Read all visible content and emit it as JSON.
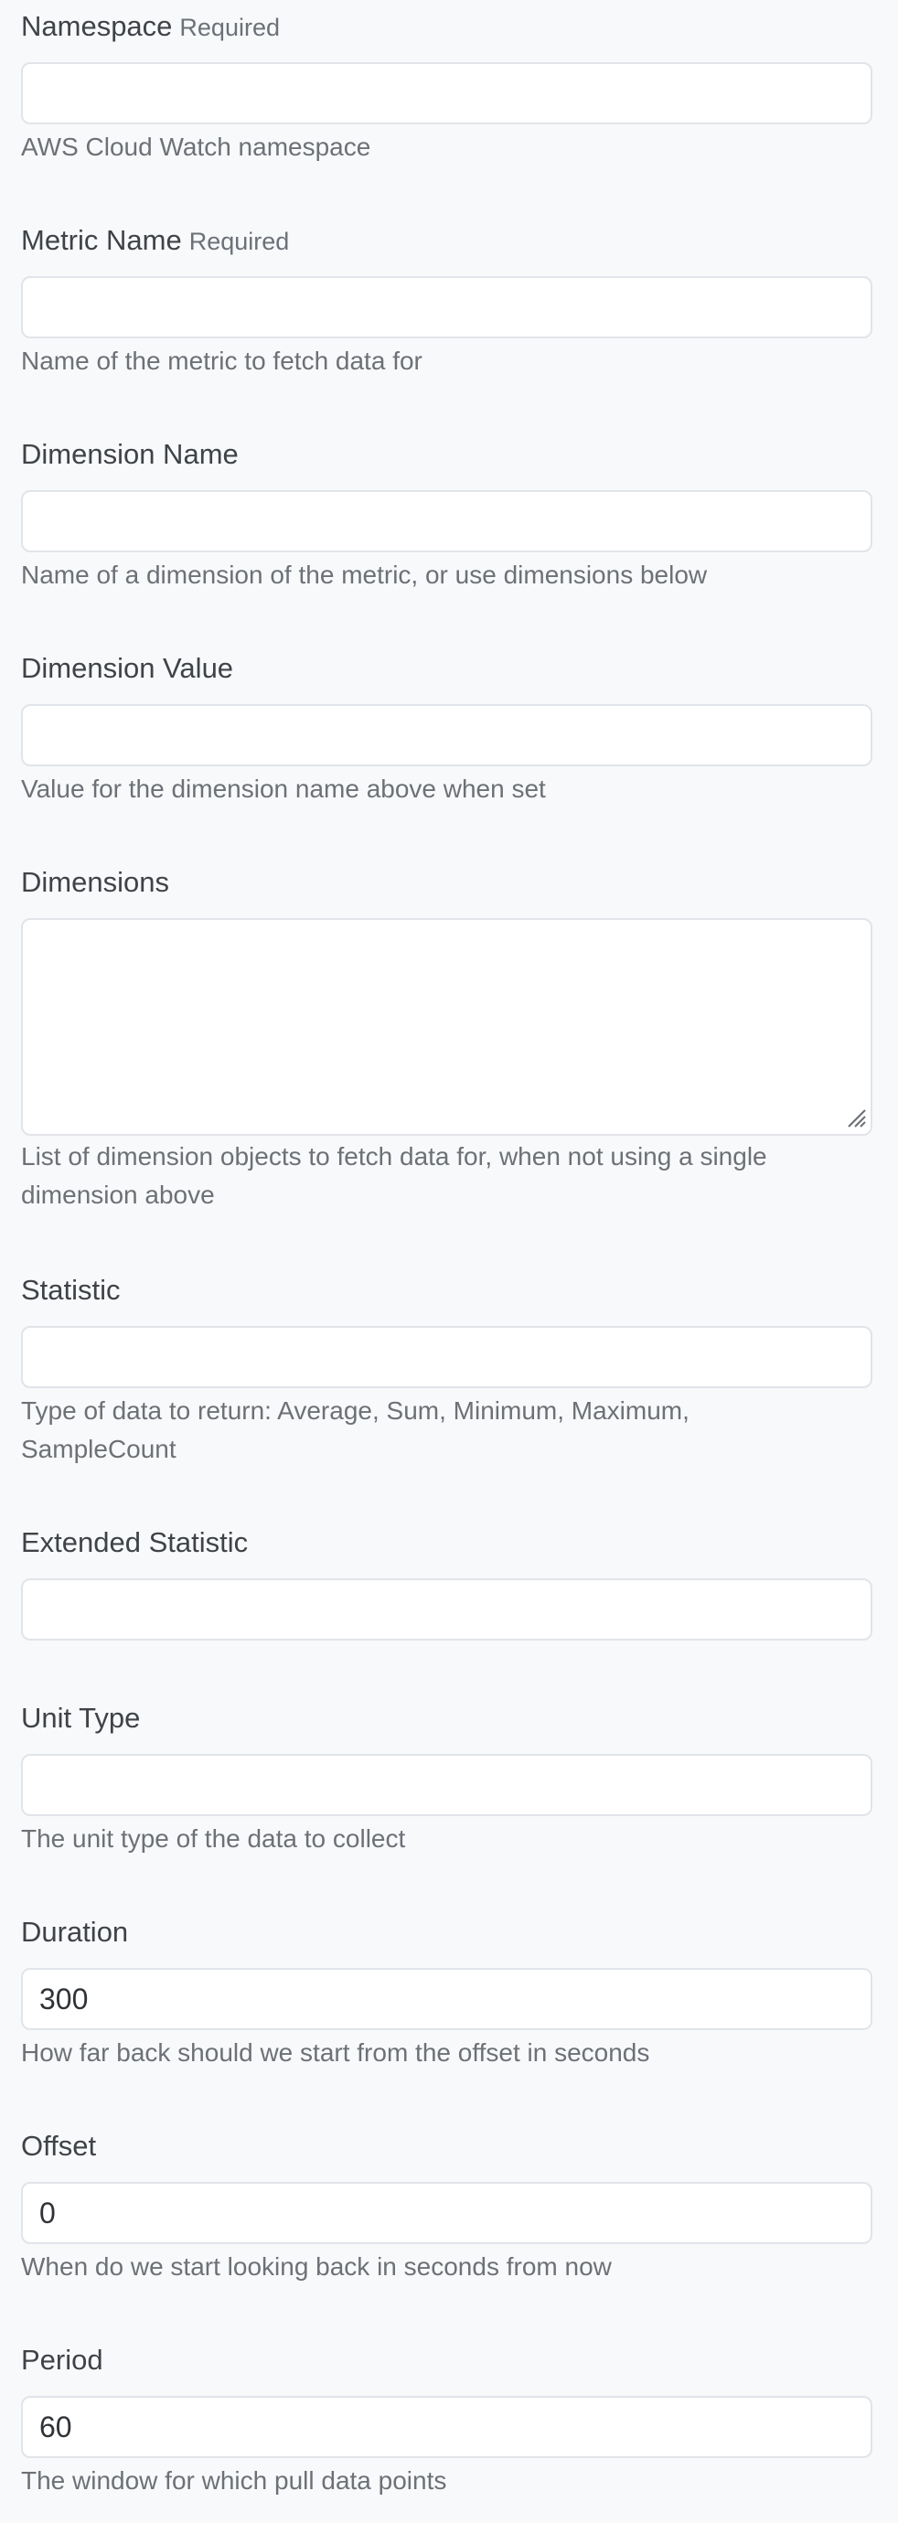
{
  "form": {
    "namespace": {
      "label": "Namespace",
      "required": "Required",
      "value": "",
      "help": "AWS Cloud Watch namespace"
    },
    "metric_name": {
      "label": "Metric Name",
      "required": "Required",
      "value": "",
      "help": "Name of the metric to fetch data for"
    },
    "dimension_name": {
      "label": "Dimension Name",
      "value": "",
      "help": "Name of a dimension of the metric, or use dimensions below"
    },
    "dimension_value": {
      "label": "Dimension Value",
      "value": "",
      "help": "Value for the dimension name above when set"
    },
    "dimensions": {
      "label": "Dimensions",
      "value": "",
      "help": "List of dimension objects to fetch data for, when not using a single dimension above"
    },
    "statistic": {
      "label": "Statistic",
      "value": "",
      "help": "Type of data to return: Average, Sum, Minimum, Maximum, SampleCount"
    },
    "extended_statistic": {
      "label": "Extended Statistic",
      "value": ""
    },
    "unit_type": {
      "label": "Unit Type",
      "value": "",
      "help": "The unit type of the data to collect"
    },
    "duration": {
      "label": "Duration",
      "value": "300",
      "help": "How far back should we start from the offset in seconds"
    },
    "offset": {
      "label": "Offset",
      "value": "0",
      "help": "When do we start looking back in seconds from now"
    },
    "period": {
      "label": "Period",
      "value": "60",
      "help": "The window for which pull data points"
    }
  }
}
